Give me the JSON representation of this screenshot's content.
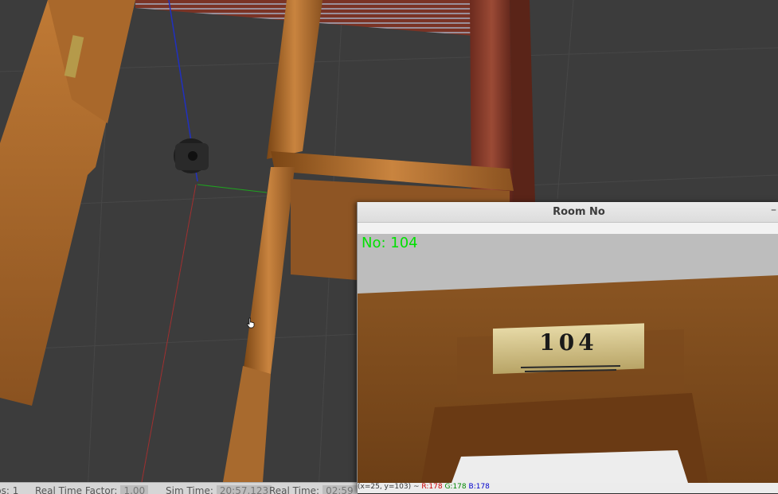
{
  "simulation": {
    "status": {
      "steps_label": "ps: 1",
      "rtf_label": "Real Time Factor:",
      "rtf_value": "1.00",
      "sim_time_label": "Sim Time:",
      "sim_time_value": "20:57.123",
      "real_time_label": "Real Time:",
      "real_time_value": "02:59"
    }
  },
  "image_window": {
    "title": "Room No",
    "minimize_glyph": "–",
    "overlay_text": "No:  104",
    "door_sign_text": "104",
    "statusbar": {
      "coords": "(x=25, y=103) ~",
      "r": "R:178",
      "g": "G:178",
      "b": "B:178"
    }
  },
  "colors": {
    "overlay_green": "#00e000",
    "r_channel": "#cc0000",
    "g_channel": "#008800",
    "b_channel": "#0000cc"
  }
}
